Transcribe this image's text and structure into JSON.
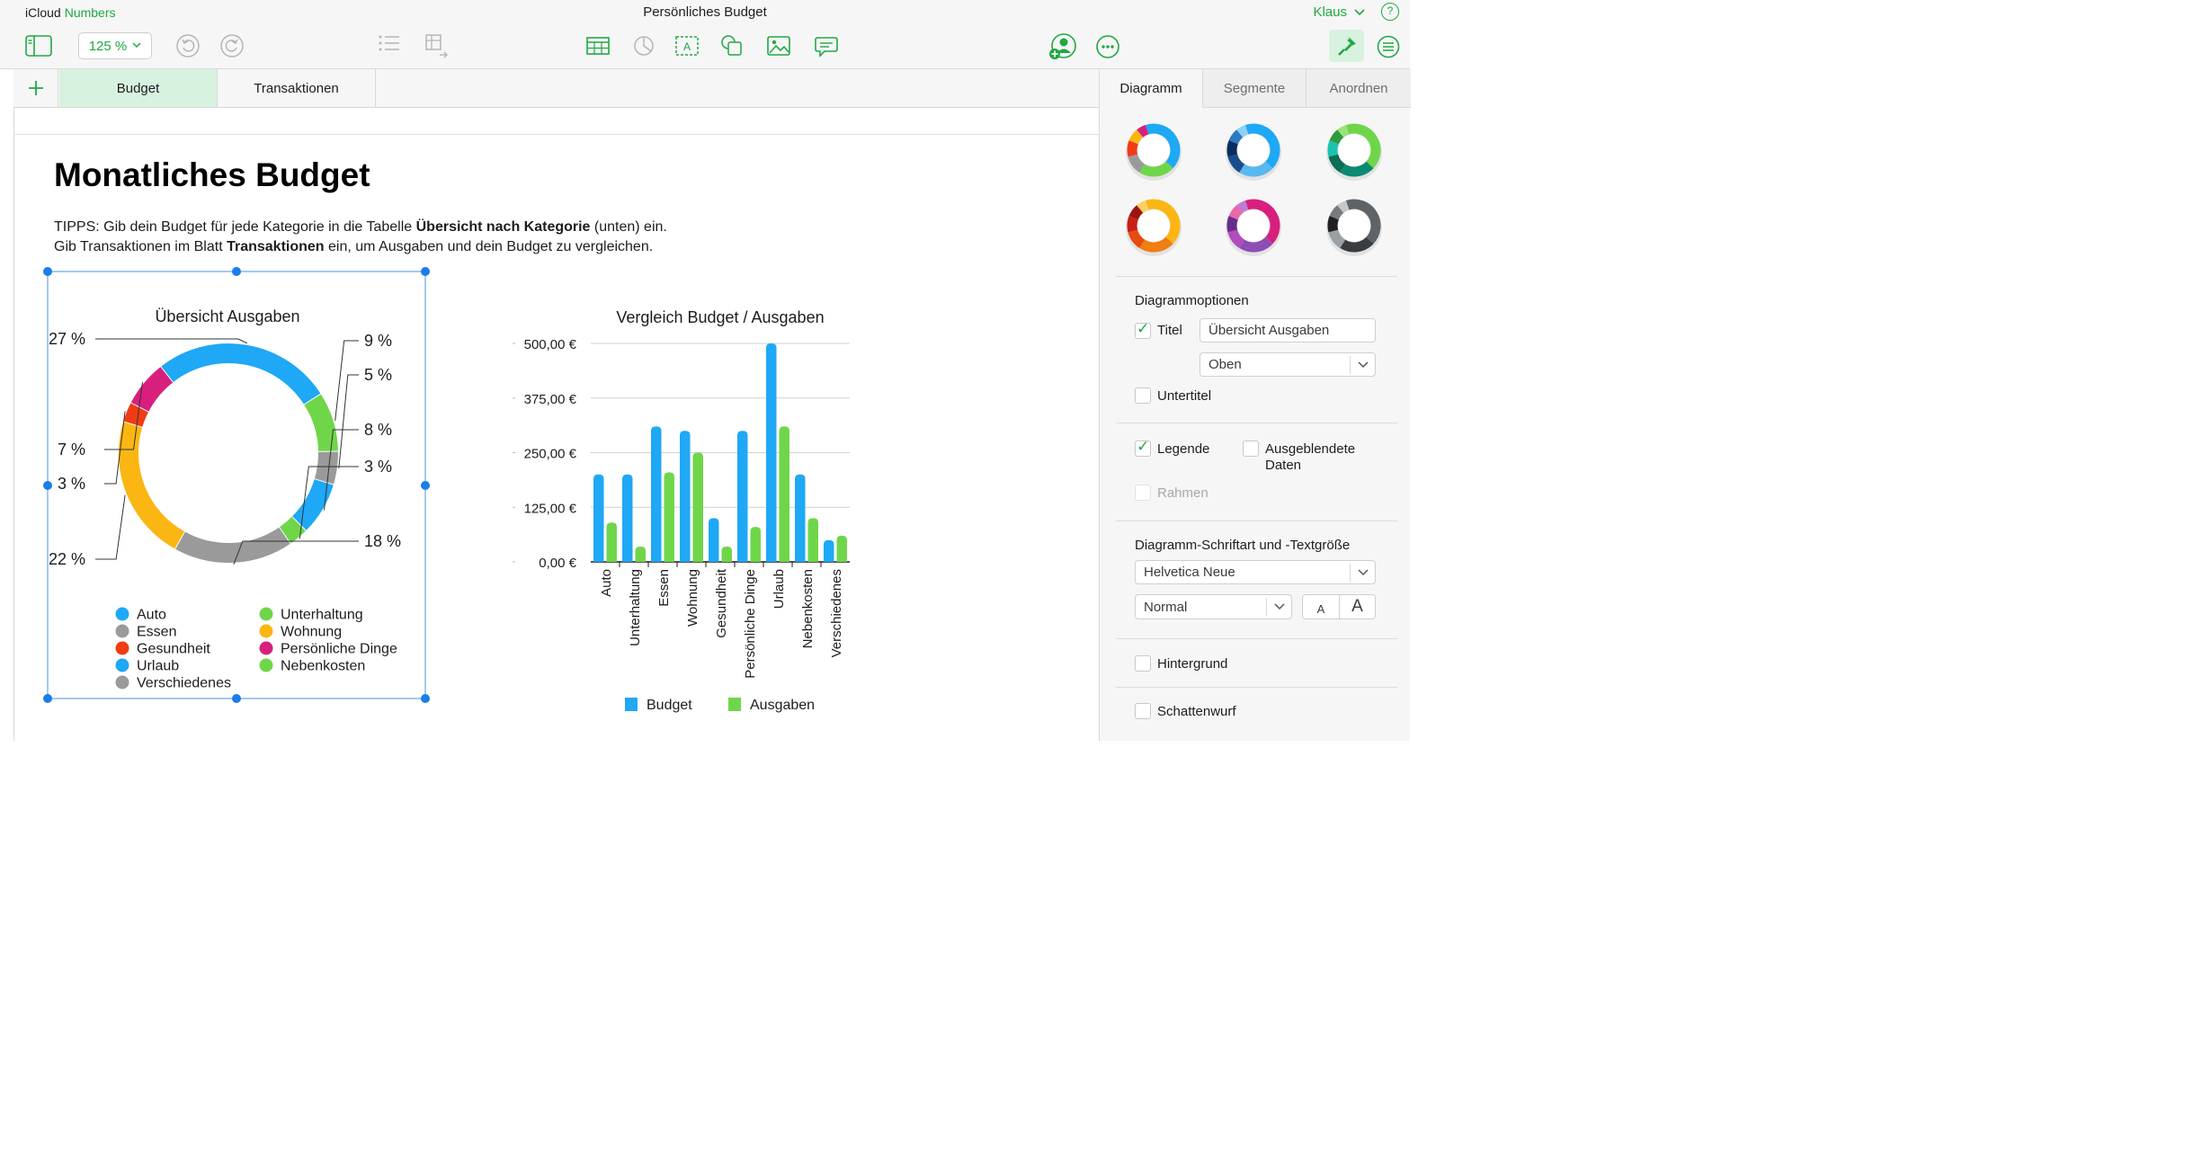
{
  "app": {
    "brand_primary": "iCloud",
    "brand_secondary": "Numbers",
    "accent_color": "#1fa843"
  },
  "document": {
    "title": "Persönliches Budget"
  },
  "user": {
    "name": "Klaus",
    "help_label": "?"
  },
  "toolbar": {
    "zoom": "125 %",
    "left_icons": [
      "sidebar-icon",
      "undo-icon",
      "redo-icon",
      "list-icon",
      "table-format-icon"
    ],
    "insert_icons": [
      "table-icon",
      "chart-icon",
      "text-icon",
      "shape-icon",
      "media-icon",
      "comment-icon"
    ],
    "right_icons": [
      "collaborate-icon",
      "more-icon",
      "format-icon",
      "organize-icon"
    ]
  },
  "sheets": {
    "add_label": "+",
    "tabs": [
      {
        "label": "Budget",
        "active": true
      },
      {
        "label": "Transaktionen",
        "active": false
      }
    ]
  },
  "canvas": {
    "headline": "Monatliches Budget",
    "tip_line1": {
      "a": "TIPPS: Gib dein Budget für jede Kategorie in die Tabelle ",
      "b": "Übersicht nach Kategorie",
      "c": " (unten) ein."
    },
    "tip_line2": {
      "a": "Gib Transaktionen im Blatt ",
      "b": "Transaktionen",
      "c": " ein, um Ausgaben und dein Budget zu vergleichen."
    }
  },
  "chart_data": [
    {
      "type": "pie",
      "title": "Übersicht Ausgaben",
      "slices": [
        {
          "name": "Auto",
          "value": 27,
          "label": "27 %",
          "color": "#1fa8f5"
        },
        {
          "name": "Unterhaltung",
          "value": 9,
          "label": "9 %",
          "color": "#6fd64a"
        },
        {
          "name": "Essen",
          "value": 5,
          "label": "5 %",
          "color": "#9a9a9a"
        },
        {
          "name": "Urlaub",
          "value": 8,
          "label": "8 %",
          "color": "#1fa8f5"
        },
        {
          "name": "Nebenkosten",
          "value": 3,
          "label": "3 %",
          "color": "#6fd64a"
        },
        {
          "name": "Verschiedenes",
          "value": 18,
          "label": "18 %",
          "color": "#9a9a9a"
        },
        {
          "name": "Wohnung",
          "value": 22,
          "label": "22 %",
          "color": "#fbb613"
        },
        {
          "name": "Gesundheit",
          "value": 3,
          "label": "3 %",
          "color": "#f03c15"
        },
        {
          "name": "Persönliche Dinge",
          "value": 7,
          "label": "7 %",
          "color": "#d81f7e"
        }
      ],
      "legend": [
        {
          "name": "Auto",
          "color": "#1fa8f5"
        },
        {
          "name": "Unterhaltung",
          "color": "#6fd64a"
        },
        {
          "name": "Essen",
          "color": "#9a9a9a"
        },
        {
          "name": "Wohnung",
          "color": "#fbb613"
        },
        {
          "name": "Gesundheit",
          "color": "#f03c15"
        },
        {
          "name": "Persönliche Dinge",
          "color": "#d81f7e"
        },
        {
          "name": "Urlaub",
          "color": "#1fa8f5"
        },
        {
          "name": "Nebenkosten",
          "color": "#6fd64a"
        },
        {
          "name": "Verschiedenes",
          "color": "#9a9a9a"
        }
      ],
      "legend_position": "bottom",
      "donut": true
    },
    {
      "type": "bar",
      "title": "Vergleich Budget / Ausgaben",
      "categories": [
        "Auto",
        "Unterhaltung",
        "Essen",
        "Wohnung",
        "Gesundheit",
        "Persönliche Dinge",
        "Urlaub",
        "Nebenkosten",
        "Verschiedenes"
      ],
      "series": [
        {
          "name": "Budget",
          "color": "#1fa8f5",
          "values": [
            200,
            200,
            310,
            300,
            100,
            300,
            500,
            200,
            50
          ]
        },
        {
          "name": "Ausgaben",
          "color": "#6fd64a",
          "values": [
            90,
            35,
            205,
            250,
            35,
            80,
            310,
            100,
            60
          ]
        }
      ],
      "ylim": [
        0,
        500
      ],
      "y_ticks": [
        0,
        125,
        250,
        375,
        500
      ],
      "y_tick_labels": [
        "0,00 €",
        "125,00 €",
        "250,00 €",
        "375,00 €",
        "500,00 €"
      ],
      "grid": true,
      "legend_position": "bottom"
    }
  ],
  "panel": {
    "tabs": [
      {
        "label": "Diagramm",
        "active": true
      },
      {
        "label": "Segmente",
        "active": false
      },
      {
        "label": "Anordnen",
        "active": false
      }
    ],
    "styles": [
      {
        "colors": [
          "#1fa8f5",
          "#6fd64a",
          "#9a9a9a",
          "#f03c15",
          "#fbb613",
          "#d81f7e"
        ]
      },
      {
        "colors": [
          "#1fa8f5",
          "#58b8f0",
          "#1a4e8a",
          "#0a2d5e",
          "#2f79c2",
          "#8fd0f7"
        ]
      },
      {
        "colors": [
          "#6fd64a",
          "#0a8a70",
          "#0b6e55",
          "#19c4b0",
          "#2a9c3c",
          "#9ae27a"
        ]
      },
      {
        "colors": [
          "#fbb613",
          "#f07e12",
          "#e84a10",
          "#c91f14",
          "#9a1610",
          "#fdd064"
        ]
      },
      {
        "colors": [
          "#d81f7e",
          "#8e4cb5",
          "#b14dbe",
          "#6a2c8c",
          "#e86aa8",
          "#c07ad6"
        ]
      },
      {
        "colors": [
          "#5e6367",
          "#3a3d40",
          "#9aa0a4",
          "#1f2124",
          "#767b80",
          "#c4c8cb"
        ]
      }
    ],
    "chart_options": {
      "heading": "Diagrammoptionen",
      "title_label": "Titel",
      "title_checked": true,
      "title_value": "Übersicht Ausgaben",
      "title_position": "Oben",
      "subtitle_label": "Untertitel",
      "subtitle_checked": false,
      "legend_label": "Legende",
      "legend_checked": true,
      "hidden_data_label_1": "Ausgeblendete",
      "hidden_data_label_2": "Daten",
      "hidden_data_checked": false,
      "border_label": "Rahmen",
      "border_checked": false
    },
    "font": {
      "heading": "Diagramm-Schriftart und -Textgröße",
      "family": "Helvetica Neue",
      "style": "Normal",
      "smaller": "A",
      "larger": "A"
    },
    "background": {
      "label": "Hintergrund",
      "checked": false
    },
    "shadow": {
      "label": "Schattenwurf",
      "checked": false
    }
  }
}
